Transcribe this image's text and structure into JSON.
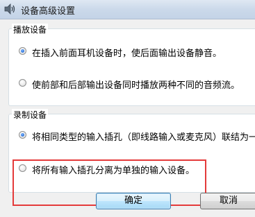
{
  "window": {
    "title": "设备高级设置"
  },
  "playback_group": {
    "legend": "播放设备",
    "options": [
      {
        "label": "在插入前面耳机设备时，使后面输出设备静音。",
        "checked": true
      },
      {
        "label": "使前部和后部输出设备同时播放两种不同的音频流。",
        "checked": false
      }
    ]
  },
  "record_group": {
    "legend": "录制设备",
    "options": [
      {
        "label": "将相同类型的输入插孔（即线路输入或麦克风）联结为一",
        "checked": true
      },
      {
        "label": "将所有输入插孔分离为单独的输入设备。",
        "checked": false
      }
    ]
  },
  "buttons": {
    "ok": "确定",
    "cancel": "取消"
  },
  "icons": {
    "title": "speaker-icon"
  },
  "colors": {
    "highlight": "#e43a3a",
    "radio_selected": "#2a6fd6"
  }
}
